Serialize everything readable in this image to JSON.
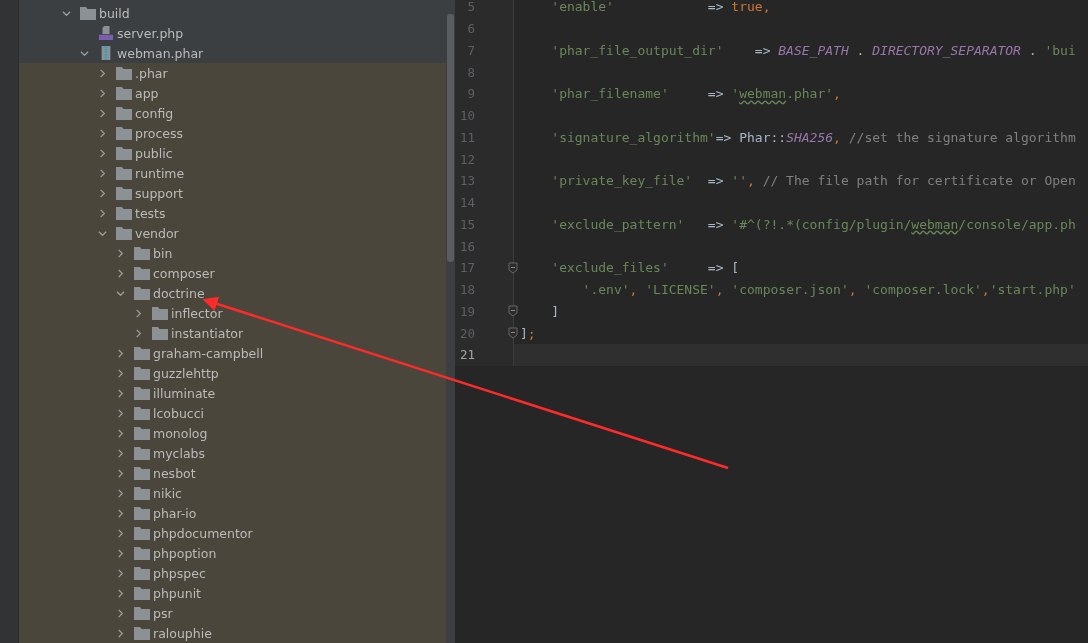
{
  "tree": [
    {
      "name": "build",
      "kind": "folder",
      "expanded": true,
      "highlighted": false,
      "children": [
        {
          "name": "server.php",
          "kind": "php-file",
          "highlighted": false
        },
        {
          "name": "webman.phar",
          "kind": "archive",
          "expanded": true,
          "highlighted": false,
          "children": [
            {
              "name": ".phar",
              "kind": "folder",
              "expanded": false,
              "highlighted": true
            },
            {
              "name": "app",
              "kind": "folder",
              "expanded": false,
              "highlighted": true
            },
            {
              "name": "config",
              "kind": "folder",
              "expanded": false,
              "highlighted": true
            },
            {
              "name": "process",
              "kind": "folder",
              "expanded": false,
              "highlighted": true
            },
            {
              "name": "public",
              "kind": "folder",
              "expanded": false,
              "highlighted": true
            },
            {
              "name": "runtime",
              "kind": "folder",
              "expanded": false,
              "highlighted": true
            },
            {
              "name": "support",
              "kind": "folder",
              "expanded": false,
              "highlighted": true
            },
            {
              "name": "tests",
              "kind": "folder",
              "expanded": false,
              "highlighted": true
            },
            {
              "name": "vendor",
              "kind": "folder",
              "expanded": true,
              "highlighted": true,
              "children": [
                {
                  "name": "bin",
                  "kind": "folder",
                  "expanded": false,
                  "highlighted": true
                },
                {
                  "name": "composer",
                  "kind": "folder",
                  "expanded": false,
                  "highlighted": true
                },
                {
                  "name": "doctrine",
                  "kind": "folder",
                  "expanded": true,
                  "highlighted": true,
                  "children": [
                    {
                      "name": "inflector",
                      "kind": "folder",
                      "expanded": false,
                      "highlighted": true
                    },
                    {
                      "name": "instantiator",
                      "kind": "folder",
                      "expanded": false,
                      "highlighted": true
                    }
                  ]
                },
                {
                  "name": "graham-campbell",
                  "kind": "folder",
                  "expanded": false,
                  "highlighted": true
                },
                {
                  "name": "guzzlehttp",
                  "kind": "folder",
                  "expanded": false,
                  "highlighted": true
                },
                {
                  "name": "illuminate",
                  "kind": "folder",
                  "expanded": false,
                  "highlighted": true
                },
                {
                  "name": "lcobucci",
                  "kind": "folder",
                  "expanded": false,
                  "highlighted": true
                },
                {
                  "name": "monolog",
                  "kind": "folder",
                  "expanded": false,
                  "highlighted": true
                },
                {
                  "name": "myclabs",
                  "kind": "folder",
                  "expanded": false,
                  "highlighted": true
                },
                {
                  "name": "nesbot",
                  "kind": "folder",
                  "expanded": false,
                  "highlighted": true
                },
                {
                  "name": "nikic",
                  "kind": "folder",
                  "expanded": false,
                  "highlighted": true
                },
                {
                  "name": "phar-io",
                  "kind": "folder",
                  "expanded": false,
                  "highlighted": true
                },
                {
                  "name": "phpdocumentor",
                  "kind": "folder",
                  "expanded": false,
                  "highlighted": true
                },
                {
                  "name": "phpoption",
                  "kind": "folder",
                  "expanded": false,
                  "highlighted": true
                },
                {
                  "name": "phpspec",
                  "kind": "folder",
                  "expanded": false,
                  "highlighted": true
                },
                {
                  "name": "phpunit",
                  "kind": "folder",
                  "expanded": false,
                  "highlighted": true
                },
                {
                  "name": "psr",
                  "kind": "folder",
                  "expanded": false,
                  "highlighted": true
                },
                {
                  "name": "ralouphie",
                  "kind": "folder",
                  "expanded": false,
                  "highlighted": true
                }
              ]
            }
          ]
        }
      ]
    }
  ],
  "code": [
    {
      "number": "5",
      "current": false,
      "fold_marker": false,
      "tokens": [
        {
          "kind": "string",
          "text": "    'enable'"
        },
        {
          "kind": "plain",
          "text": "            => "
        },
        {
          "kind": "keyword",
          "text": "true"
        },
        {
          "kind": "punct",
          "text": ","
        }
      ]
    },
    {
      "number": "6",
      "current": false,
      "fold_marker": false
    },
    {
      "number": "7",
      "current": false,
      "fold_marker": false,
      "tokens": [
        {
          "kind": "string",
          "text": "    'phar_file_output_dir'"
        },
        {
          "kind": "plain",
          "text": "    => "
        },
        {
          "kind": "constant",
          "text": "BASE_PATH"
        },
        {
          "kind": "plain",
          "text": " . "
        },
        {
          "kind": "constant",
          "text": "DIRECTORY_SEPARATOR"
        },
        {
          "kind": "plain",
          "text": " . "
        },
        {
          "kind": "string",
          "text": "'bui"
        }
      ]
    },
    {
      "number": "8",
      "current": false,
      "fold_marker": false
    },
    {
      "number": "9",
      "current": false,
      "fold_marker": false,
      "tokens": [
        {
          "kind": "string",
          "text": "    'phar_filename'"
        },
        {
          "kind": "plain",
          "text": "     => "
        },
        {
          "kind": "string",
          "text": "'"
        },
        {
          "kind": "typo",
          "text": "webman"
        },
        {
          "kind": "string",
          "text": ".phar'"
        },
        {
          "kind": "punct",
          "text": ","
        }
      ]
    },
    {
      "number": "10",
      "current": false,
      "fold_marker": false
    },
    {
      "number": "11",
      "current": false,
      "fold_marker": false,
      "tokens": [
        {
          "kind": "string",
          "text": "    'signature_algorithm'"
        },
        {
          "kind": "plain",
          "text": "=> Phar::"
        },
        {
          "kind": "constant",
          "text": "SHA256"
        },
        {
          "kind": "punct",
          "text": ", "
        },
        {
          "kind": "comment",
          "text": "//set the signature algorithm"
        }
      ]
    },
    {
      "number": "12",
      "current": false,
      "fold_marker": false
    },
    {
      "number": "13",
      "current": false,
      "fold_marker": false,
      "tokens": [
        {
          "kind": "string",
          "text": "    'private_key_file'"
        },
        {
          "kind": "plain",
          "text": "  => "
        },
        {
          "kind": "string",
          "text": "''"
        },
        {
          "kind": "punct",
          "text": ", "
        },
        {
          "kind": "comment",
          "text": "// The file path for certificate or Open"
        }
      ]
    },
    {
      "number": "14",
      "current": false,
      "fold_marker": false
    },
    {
      "number": "15",
      "current": false,
      "fold_marker": false,
      "tokens": [
        {
          "kind": "string",
          "text": "    'exclude_pattern'"
        },
        {
          "kind": "plain",
          "text": "   => "
        },
        {
          "kind": "string",
          "text": "'#^(?!.*(config/plugin/"
        },
        {
          "kind": "typo",
          "text": "webman"
        },
        {
          "kind": "string",
          "text": "/console/app.ph"
        }
      ]
    },
    {
      "number": "16",
      "current": false,
      "fold_marker": false
    },
    {
      "number": "17",
      "current": false,
      "fold_marker": true,
      "tokens": [
        {
          "kind": "string",
          "text": "    'exclude_files'"
        },
        {
          "kind": "plain",
          "text": "     => ["
        }
      ]
    },
    {
      "number": "18",
      "current": false,
      "fold_marker": false,
      "tokens": [
        {
          "kind": "string",
          "text": "        '.env'"
        },
        {
          "kind": "punct",
          "text": ", "
        },
        {
          "kind": "string",
          "text": "'LICENSE'"
        },
        {
          "kind": "punct",
          "text": ", "
        },
        {
          "kind": "string",
          "text": "'composer.json'"
        },
        {
          "kind": "punct",
          "text": ", "
        },
        {
          "kind": "string",
          "text": "'composer.lock'"
        },
        {
          "kind": "punct",
          "text": ","
        },
        {
          "kind": "string",
          "text": "'start.php'"
        }
      ]
    },
    {
      "number": "19",
      "current": false,
      "fold_marker": true,
      "tokens": [
        {
          "kind": "plain",
          "text": "    ]"
        }
      ]
    },
    {
      "number": "20",
      "current": false,
      "fold_marker": true,
      "tokens": [
        {
          "kind": "plain",
          "text": "]"
        },
        {
          "kind": "punct",
          "text": ";"
        }
      ]
    },
    {
      "number": "21",
      "current": true,
      "fold_marker": false
    }
  ]
}
